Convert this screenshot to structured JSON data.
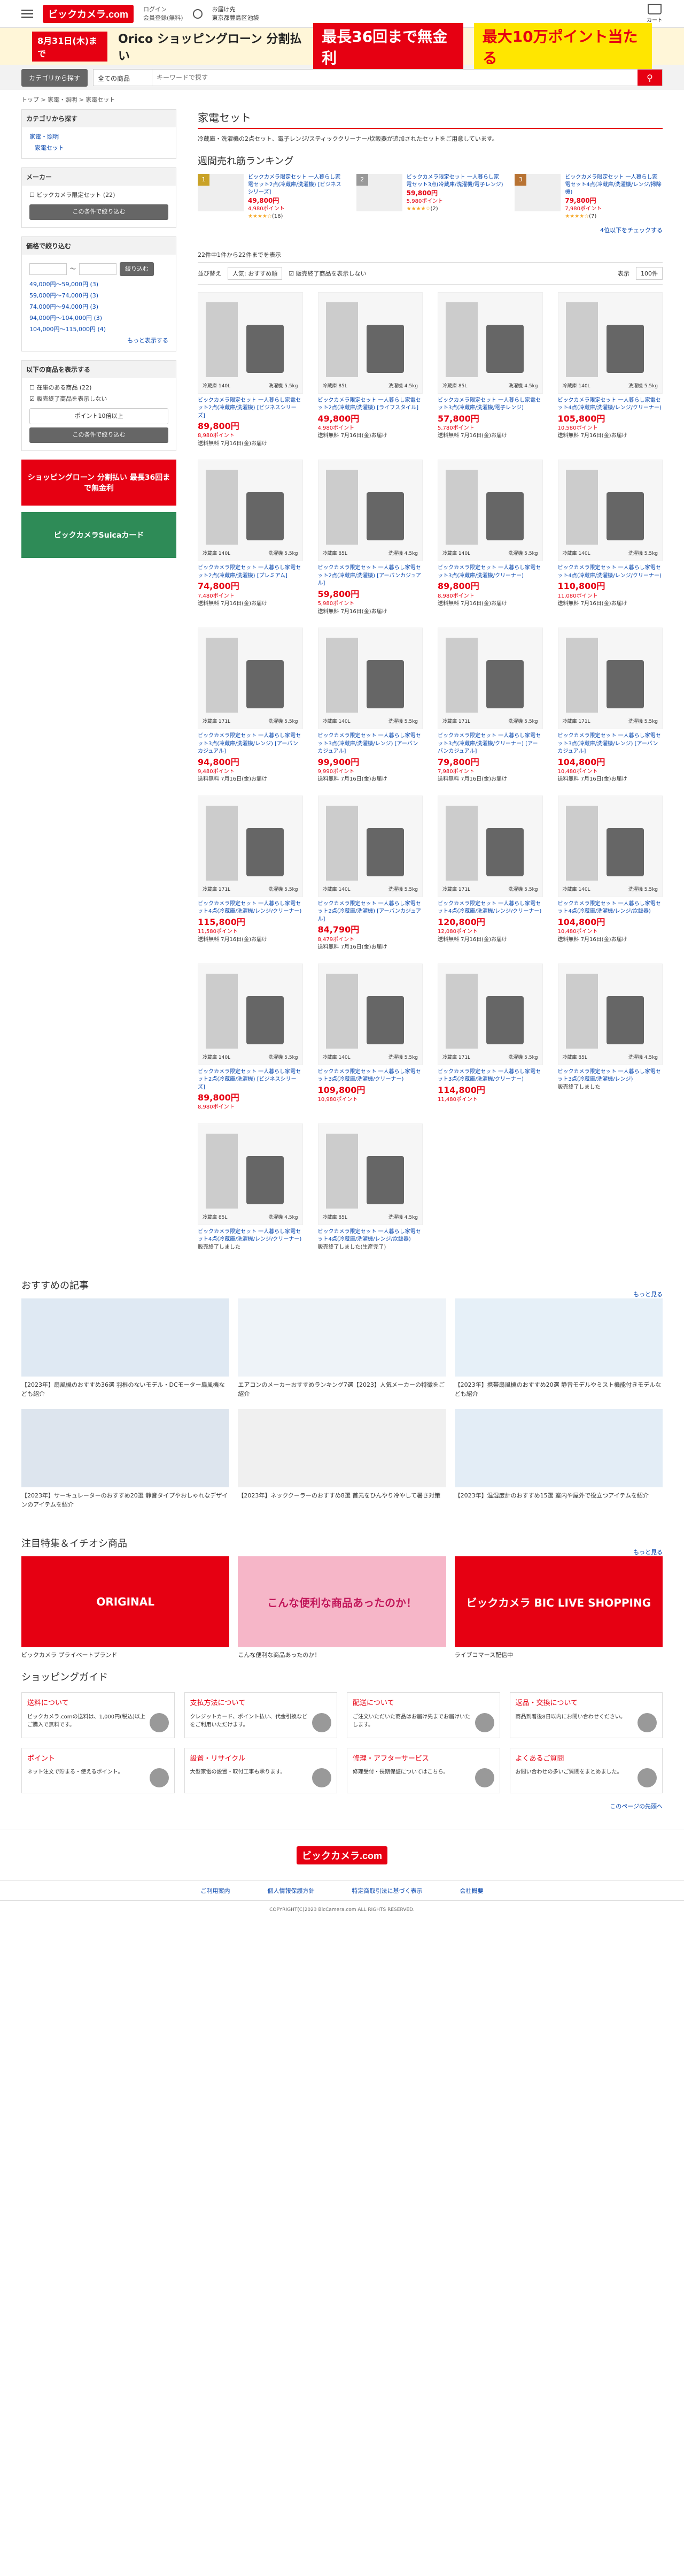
{
  "header": {
    "logo": "ビックカメラ.com",
    "login_line1": "ログイン",
    "login_line2": "会員登録(無料)",
    "delivery_line1": "お届け先",
    "delivery_line2": "東京都豊島区池袋",
    "cart_label": "カート"
  },
  "banner": {
    "date": "8月31日(木)まで",
    "orico": "Orico ショッピングローン 分割払い",
    "max": "最長36回まで無金利",
    "prize": "最大10万ポイント当たる"
  },
  "search": {
    "category_button": "カテゴリから探す",
    "select": "全ての商品",
    "placeholder": "キーワードで探す",
    "button_icon": "search-icon"
  },
  "breadcrumb": "トップ > 家電・照明 > 家電セット",
  "sidebar": {
    "cat_title": "カテゴリから探す",
    "cat_items": [
      "家電・照明",
      "家電セット"
    ],
    "maker_title": "メーカー",
    "maker_items": [
      "ビックカメラ限定セット (22)"
    ],
    "maker_btn": "この条件で絞り込む",
    "price_title": "価格で絞り込む",
    "price_btn": "絞り込む",
    "price_ranges": [
      "49,000円〜59,000円 (3)",
      "59,000円〜74,000円 (3)",
      "74,000円〜94,000円 (3)",
      "94,000円〜104,000円 (3)",
      "104,000円〜115,000円 (4)"
    ],
    "price_more": "もっと表示する",
    "cond_title": "以下の商品を表示する",
    "cond_items": [
      "在庫のある商品 (22)",
      "販売終了商品を表示しない"
    ],
    "cond_btn1": "ポイント10倍以上",
    "cond_btn2": "この条件で絞り込む",
    "ad1": "ショッピングローン 分割払い 最長36回まで無金利",
    "ad2": "ビックカメラSuicaカード"
  },
  "page": {
    "title": "家電セット",
    "desc": "冷蔵庫・洗濯機の2点セット、電子レンジ/スティッククリーナー/炊飯器が追加されたセットをご用意しています。"
  },
  "ranking": {
    "title": "週間売れ筋ランキング",
    "more": "4位以下をチェックする",
    "items": [
      {
        "rank": "1",
        "name": "ビックカメラ限定セット 一人暮らし家電セット2点(冷蔵庫/洗濯機) [ビジネスシリーズ]",
        "price": "49,800円",
        "pts": "4,980ポイント",
        "stars": "★★★★☆",
        "reviews": "(16)"
      },
      {
        "rank": "2",
        "name": "ビックカメラ限定セット 一人暮らし家電セット3点(冷蔵庫/洗濯機/電子レンジ)",
        "price": "59,800円",
        "pts": "5,980ポイント",
        "stars": "★★★★☆",
        "reviews": "(2)"
      },
      {
        "rank": "3",
        "name": "ビックカメラ限定セット 一人暮らし家電セット4点(冷蔵庫/洗濯機/レンジ/掃除機)",
        "price": "79,800円",
        "pts": "7,980ポイント",
        "stars": "★★★★☆",
        "reviews": "(7)"
      }
    ]
  },
  "controls": {
    "count": "22件中1件から22件までを表示",
    "sort_label": "並び替え",
    "sort_value": "人気: おすすめ順",
    "hide_label": "販売終了商品を表示しない",
    "per_page_label": "表示",
    "per_page_value": "100件"
  },
  "products": [
    {
      "name": "ビックカメラ限定セット 一人暮らし家電セット2点(冷蔵庫/洗濯機) [ビジネスシリーズ]",
      "price": "89,800円",
      "pts": "8,980ポイント",
      "ship": "送料無料 7月16日(金)お届け",
      "cap1": "冷蔵庫 140L",
      "cap2": "洗濯機 5.5kg"
    },
    {
      "name": "ビックカメラ限定セット 一人暮らし家電セット2点(冷蔵庫/洗濯機) [ライフスタイル]",
      "price": "49,800円",
      "pts": "4,980ポイント",
      "ship": "送料無料 7月16日(金)お届け",
      "cap1": "冷蔵庫 85L",
      "cap2": "洗濯機 4.5kg"
    },
    {
      "name": "ビックカメラ限定セット 一人暮らし家電セット3点(冷蔵庫/洗濯機/電子レンジ)",
      "price": "57,800円",
      "pts": "5,780ポイント",
      "ship": "送料無料 7月16日(金)お届け",
      "cap1": "冷蔵庫 85L",
      "cap2": "洗濯機 4.5kg"
    },
    {
      "name": "ビックカメラ限定セット 一人暮らし家電セット4点(冷蔵庫/洗濯機/レンジ/クリーナー)",
      "price": "105,800円",
      "pts": "10,580ポイント",
      "ship": "送料無料 7月16日(金)お届け",
      "cap1": "冷蔵庫 140L",
      "cap2": "洗濯機 5.5kg"
    },
    {
      "name": "ビックカメラ限定セット 一人暮らし家電セット2点(冷蔵庫/洗濯機) [プレミアム]",
      "price": "74,800円",
      "pts": "7,480ポイント",
      "ship": "送料無料 7月16日(金)お届け",
      "cap1": "冷蔵庫 140L",
      "cap2": "洗濯機 5.5kg"
    },
    {
      "name": "ビックカメラ限定セット 一人暮らし家電セット2点(冷蔵庫/洗濯機) [アーバンカジュアル]",
      "price": "59,800円",
      "pts": "5,980ポイント",
      "ship": "送料無料 7月16日(金)お届け",
      "cap1": "冷蔵庫 85L",
      "cap2": "洗濯機 4.5kg"
    },
    {
      "name": "ビックカメラ限定セット 一人暮らし家電セット3点(冷蔵庫/洗濯機/クリーナー)",
      "price": "89,800円",
      "pts": "8,980ポイント",
      "ship": "送料無料 7月16日(金)お届け",
      "cap1": "冷蔵庫 140L",
      "cap2": "洗濯機 5.5kg"
    },
    {
      "name": "ビックカメラ限定セット 一人暮らし家電セット4点(冷蔵庫/洗濯機/レンジ/クリーナー)",
      "price": "110,800円",
      "pts": "11,080ポイント",
      "ship": "送料無料 7月16日(金)お届け",
      "cap1": "冷蔵庫 140L",
      "cap2": "洗濯機 5.5kg"
    },
    {
      "name": "ビックカメラ限定セット 一人暮らし家電セット3点(冷蔵庫/洗濯機/レンジ) [アーバンカジュアル]",
      "price": "94,800円",
      "pts": "9,480ポイント",
      "ship": "送料無料 7月16日(金)お届け",
      "cap1": "冷蔵庫 171L",
      "cap2": "洗濯機 5.5kg"
    },
    {
      "name": "ビックカメラ限定セット 一人暮らし家電セット3点(冷蔵庫/洗濯機/レンジ) [アーバンカジュアル]",
      "price": "99,900円",
      "pts": "9,990ポイント",
      "ship": "送料無料 7月16日(金)お届け",
      "cap1": "冷蔵庫 140L",
      "cap2": "洗濯機 5.5kg"
    },
    {
      "name": "ビックカメラ限定セット 一人暮らし家電セット3点(冷蔵庫/洗濯機/クリーナー) [アーバンカジュアル]",
      "price": "79,800円",
      "pts": "7,980ポイント",
      "ship": "送料無料 7月16日(金)お届け",
      "cap1": "冷蔵庫 171L",
      "cap2": "洗濯機 5.5kg"
    },
    {
      "name": "ビックカメラ限定セット 一人暮らし家電セット3点(冷蔵庫/洗濯機/レンジ) [アーバンカジュアル]",
      "price": "104,800円",
      "pts": "10,480ポイント",
      "ship": "送料無料 7月16日(金)お届け",
      "cap1": "冷蔵庫 171L",
      "cap2": "洗濯機 5.5kg"
    },
    {
      "name": "ビックカメラ限定セット 一人暮らし家電セット4点(冷蔵庫/洗濯機/レンジ/クリーナー)",
      "price": "115,800円",
      "pts": "11,580ポイント",
      "ship": "送料無料 7月16日(金)お届け",
      "cap1": "冷蔵庫 171L",
      "cap2": "洗濯機 5.5kg"
    },
    {
      "name": "ビックカメラ限定セット 一人暮らし家電セット2点(冷蔵庫/洗濯機) [アーバンカジュアル]",
      "price": "84,790円",
      "pts": "8,479ポイント",
      "ship": "送料無料 7月16日(金)お届け",
      "cap1": "冷蔵庫 140L",
      "cap2": "洗濯機 5.5kg"
    },
    {
      "name": "ビックカメラ限定セット 一人暮らし家電セット4点(冷蔵庫/洗濯機/レンジ/クリーナー)",
      "price": "120,800円",
      "pts": "12,080ポイント",
      "ship": "送料無料 7月16日(金)お届け",
      "cap1": "冷蔵庫 171L",
      "cap2": "洗濯機 5.5kg"
    },
    {
      "name": "ビックカメラ限定セット 一人暮らし家電セット4点(冷蔵庫/洗濯機/レンジ/炊飯器)",
      "price": "104,800円",
      "pts": "10,480ポイント",
      "ship": "送料無料 7月16日(金)お届け",
      "cap1": "冷蔵庫 140L",
      "cap2": "洗濯機 5.5kg"
    },
    {
      "name": "ビックカメラ限定セット 一人暮らし家電セット2点(冷蔵庫/洗濯機) [ビジネスシリーズ]",
      "price": "89,800円",
      "pts": "8,980ポイント",
      "ship": "",
      "cap1": "冷蔵庫 140L",
      "cap2": "洗濯機 5.5kg"
    },
    {
      "name": "ビックカメラ限定セット 一人暮らし家電セット3点(冷蔵庫/洗濯機/クリーナー)",
      "price": "109,800円",
      "pts": "10,980ポイント",
      "ship": "",
      "cap1": "冷蔵庫 140L",
      "cap2": "洗濯機 5.5kg"
    },
    {
      "name": "ビックカメラ限定セット 一人暮らし家電セット3点(冷蔵庫/洗濯機/クリーナー)",
      "price": "114,800円",
      "pts": "11,480ポイント",
      "ship": "",
      "cap1": "冷蔵庫 171L",
      "cap2": "洗濯機 5.5kg"
    },
    {
      "name": "ビックカメラ限定セット 一人暮らし家電セット3点(冷蔵庫/洗濯機/レンジ)",
      "price": "",
      "pts": "",
      "ship": "販売終了しました",
      "cap1": "冷蔵庫 85L",
      "cap2": "洗濯機 4.5kg"
    },
    {
      "name": "ビックカメラ限定セット 一人暮らし家電セット4点(冷蔵庫/洗濯機/レンジ/クリーナー)",
      "price": "",
      "pts": "",
      "ship": "販売終了しました",
      "cap1": "冷蔵庫 85L",
      "cap2": "洗濯機 4.5kg"
    },
    {
      "name": "ビックカメラ限定セット 一人暮らし家電セット4点(冷蔵庫/洗濯機/レンジ/炊飯器)",
      "price": "",
      "pts": "",
      "ship": "販売終了しました(生産完了)",
      "cap1": "冷蔵庫 85L",
      "cap2": "洗濯機 4.5kg"
    }
  ],
  "articles": {
    "title": "おすすめの記事",
    "more": "もっと見る",
    "items": [
      "【2023年】扇風機のおすすめ36選 羽根のないモデル・DCモーター扇風機なども紹介",
      "エアコンのメーカーおすすめランキング7選【2023】人気メーカーの特徴をご紹介",
      "【2023年】携帯扇風機のおすすめ20選 静音モデルやミスト機能付きモデルなども紹介",
      "【2023年】サーキュレーターのおすすめ20選 静音タイプやおしゃれなデザインのアイテムを紹介",
      "【2023年】ネッククーラーのおすすめ8選 首元をひんやり冷やして暑さ対策",
      "【2023年】温湿度計のおすすめ15選 室内や屋外で役立つアイテムを紹介"
    ]
  },
  "features": {
    "title": "注目特集＆イチオシ商品",
    "more": "もっと見る",
    "items": [
      {
        "banner": "ORIGINAL",
        "caption": "ビックカメラ プライベートブランド"
      },
      {
        "banner": "こんな便利な商品あったのか！",
        "caption": "こんな便利な商品あったのか！"
      },
      {
        "banner": "ビックカメラ BIC LIVE SHOPPING",
        "caption": "ライブコマース配信中"
      }
    ]
  },
  "guide": {
    "title": "ショッピングガイド",
    "items": [
      {
        "title": "送料について",
        "text": "ビックカメラ.comの送料は、1,000円(税込)以上ご購入で無料です。"
      },
      {
        "title": "支払方法について",
        "text": "クレジットカード、ポイント払い、代金引換などをご利用いただけます。"
      },
      {
        "title": "配送について",
        "text": "ご注文いただいた商品はお届け先までお届けいたします。"
      },
      {
        "title": "返品・交換について",
        "text": "商品到着後8日以内にお問い合わせください。"
      },
      {
        "title": "ポイント",
        "text": "ネット注文で貯まる・使えるポイント。"
      },
      {
        "title": "設置・リサイクル",
        "text": "大型家電の設置・取付工事も承ります。"
      },
      {
        "title": "修理・アフターサービス",
        "text": "修理受付・長期保証についてはこちら。"
      },
      {
        "title": "よくあるご質問",
        "text": "お問い合わせの多いご質問をまとめました。"
      }
    ]
  },
  "pagetop": "このページの先頭へ",
  "footer": {
    "logo": "ビックカメラ.com",
    "links": [
      "ご利用案内",
      "個人情報保護方針",
      "特定商取引法に基づく表示",
      "会社概要"
    ],
    "copyright": "COPYRIGHT(C)2023 BicCamera.com ALL RIGHTS RESERVED."
  },
  "colors": {
    "brand": "#e60012",
    "star": "#f5a623"
  }
}
